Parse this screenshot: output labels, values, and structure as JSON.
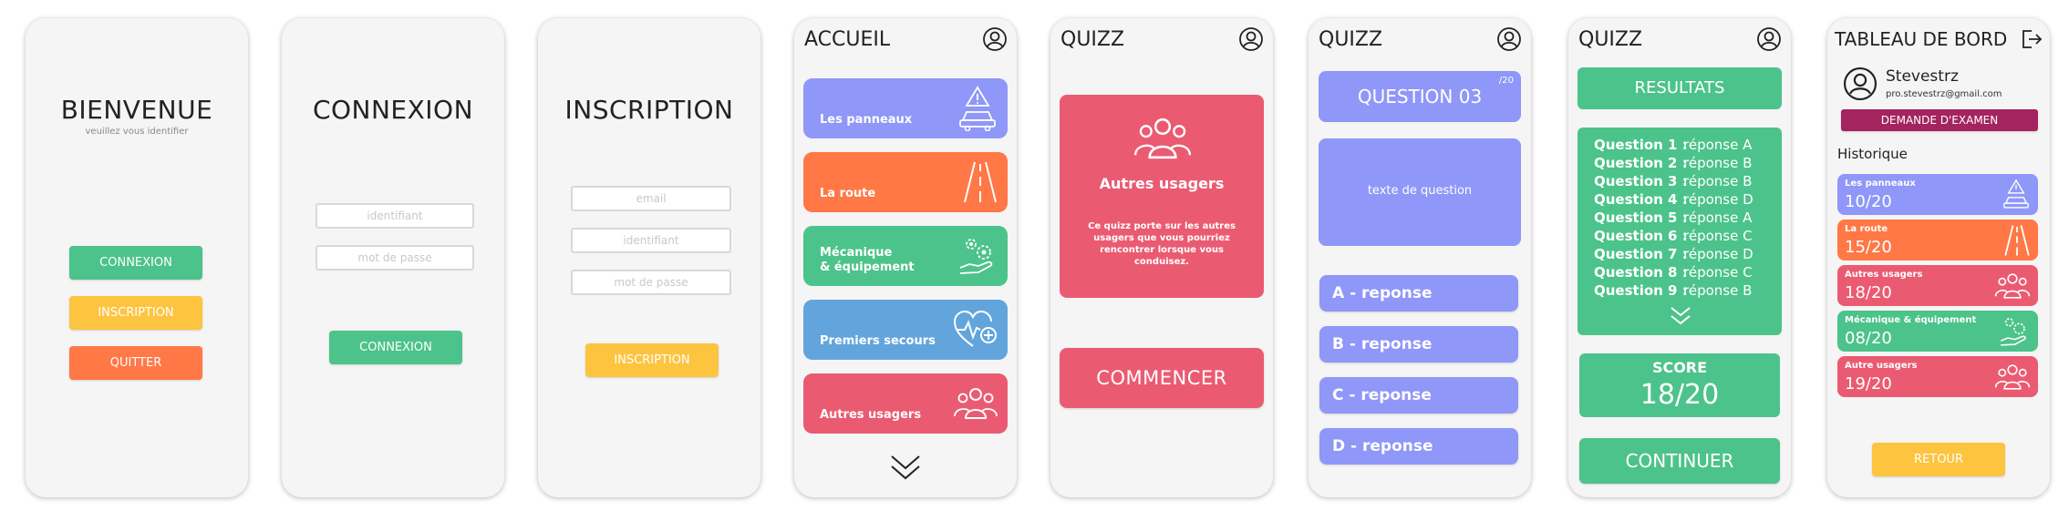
{
  "colors": {
    "green": "#4cc38a",
    "yellow": "#fdc440",
    "orange": "#ff7846",
    "periwinkle": "#8f97f8",
    "blue": "#62a5dc",
    "pink": "#ea5b72",
    "purple": "#a3245f"
  },
  "screen1": {
    "title": "BIENVENUE",
    "subtitle": "veuillez vous identifier",
    "btn_connexion": "CONNEXION",
    "btn_inscription": "INSCRIPTION",
    "btn_quitter": "QUITTER"
  },
  "screen2": {
    "title": "CONNEXION",
    "ph_identifiant": "identifiant",
    "ph_password": "mot de passe",
    "btn_connexion": "CONNEXION"
  },
  "screen3": {
    "title": "INSCRIPTION",
    "ph_email": "email",
    "ph_identifiant": "identifiant",
    "ph_password": "mot de passe",
    "btn_inscription": "INSCRIPTION"
  },
  "screen4": {
    "title": "ACCUEIL",
    "cards": [
      {
        "label": "Les panneaux",
        "icon": "road-sign-car-icon"
      },
      {
        "label": "La route",
        "icon": "road-icon"
      },
      {
        "label_line1": "Mécanique",
        "label_line2": "& équipement",
        "icon": "gears-hand-icon"
      },
      {
        "label": "Premiers secours",
        "icon": "heart-pulse-icon"
      },
      {
        "label": "Autres usagers",
        "icon": "people-group-icon"
      }
    ]
  },
  "screen5": {
    "title": "QUIZZ",
    "card_title": "Autres usagers",
    "card_desc": "Ce quizz porte sur les autres usagers que vous pourriez rencontrer lorsque vous conduisez.",
    "btn_start": "COMMENCER"
  },
  "screen6": {
    "title": "QUIZZ",
    "question": "QUESTION 03",
    "total": "/20",
    "question_text": "texte de question",
    "answers": [
      "A - reponse",
      "B - reponse",
      "C - reponse",
      "D - reponse"
    ]
  },
  "screen7": {
    "title": "QUIZZ",
    "results_label": "RESULTATS",
    "rows": [
      {
        "q": "Question 1 :",
        "a": "réponse A"
      },
      {
        "q": "Question 2 :",
        "a": "réponse B"
      },
      {
        "q": "Question 3 :",
        "a": "réponse B"
      },
      {
        "q": "Question 4 :",
        "a": "réponse D"
      },
      {
        "q": "Question 5 :",
        "a": "réponse A"
      },
      {
        "q": "Question 6 :",
        "a": "réponse C"
      },
      {
        "q": "Question 7 :",
        "a": "réponse D"
      },
      {
        "q": "Question 8 :",
        "a": "réponse C"
      },
      {
        "q": "Question 9 :",
        "a": "réponse B"
      }
    ],
    "score_label": "SCORE",
    "score_value": "18/20",
    "btn_continue": "CONTINUER"
  },
  "screen8": {
    "title": "TABLEAU DE BORD",
    "username": "Stevestrz",
    "email": "pro.stevestrz@gmail.com",
    "btn_exam": "DEMANDE D'EXAMEN",
    "history_label": "Historique",
    "history": [
      {
        "name": "Les panneaux",
        "score": "10/20"
      },
      {
        "name": "La route",
        "score": "15/20"
      },
      {
        "name": "Autres usagers",
        "score": "18/20"
      },
      {
        "name": "Mécanique & équipement",
        "score": "08/20"
      },
      {
        "name": "Autre usagers",
        "score": "19/20"
      }
    ],
    "btn_back": "RETOUR"
  }
}
